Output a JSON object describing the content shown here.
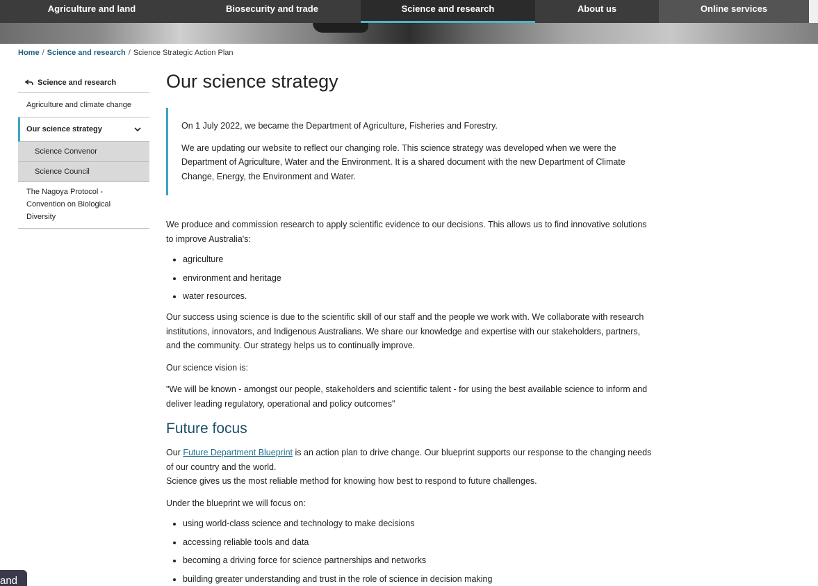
{
  "nav": {
    "items": [
      {
        "label": "Agriculture and land"
      },
      {
        "label": "Biosecurity and trade"
      },
      {
        "label": "Science and research"
      },
      {
        "label": "About us"
      },
      {
        "label": "Online services"
      }
    ]
  },
  "breadcrumb": {
    "home": "Home",
    "section": "Science and research",
    "current": "Science Strategic Action Plan",
    "separator": "/"
  },
  "sidebar": {
    "back_label": "Science and research",
    "items": [
      {
        "label": "Agriculture and climate change"
      },
      {
        "label": "Our science strategy"
      },
      {
        "label": "Science Convenor"
      },
      {
        "label": "Science Council"
      },
      {
        "label": "The Nagoya Protocol - Convention on Biological Diversity"
      }
    ]
  },
  "main": {
    "title": "Our science strategy",
    "callout": {
      "p1": "On 1 July 2022, we became the Department of Agriculture, Fisheries and Forestry.",
      "p2": "We are updating our website to reflect our changing role. This science strategy was developed when we were the Department of Agriculture, Water and the Environment. It is a shared document with the new Department of Climate Change, Energy, the Environment and Water."
    },
    "intro": "We produce and commission research to apply scientific evidence to our decisions. This allows us to find innovative solutions to improve Australia's:",
    "improve_list": [
      "agriculture",
      "environment and heritage",
      "water resources."
    ],
    "success": "Our success using science is due to the scientific skill of our staff and the people we work with. We collaborate with research institutions, innovators, and Indigenous Australians. We share our knowledge and expertise with our stakeholders, partners, and the community. Our strategy helps us to continually improve.",
    "vision_intro": "Our science vision is:",
    "vision": "\"We will be known - amongst our people, stakeholders and scientific talent - for using the best available science to inform and deliver leading regulatory, operational and policy outcomes\"",
    "future_heading": "Future focus",
    "future_p_prefix": "Our ",
    "future_link": "Future Department Blueprint",
    "future_p_suffix": " is an action plan to drive change. Our blueprint supports our response to the changing needs of our country and the world.",
    "future_p_line2": "Science gives us the most reliable method for knowing how best to respond to future challenges.",
    "focus_intro": "Under the blueprint we will focus on:",
    "focus_list": [
      "using world-class science and technology to make decisions",
      "accessing reliable tools and data",
      "becoming a driving force for science partnerships and networks",
      "building greater understanding and trust in the role of science in decision making"
    ]
  },
  "chip": {
    "label": "and"
  },
  "colors": {
    "nav_bg": "#3c3c3c",
    "accent": "#3aa5bf",
    "link": "#1d5f7a",
    "heading": "#1d4f6b"
  }
}
